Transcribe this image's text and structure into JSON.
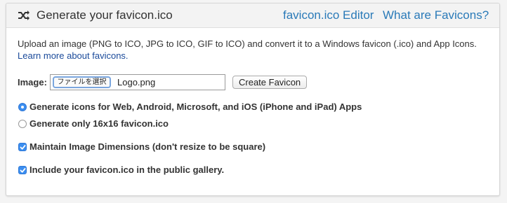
{
  "header": {
    "title": "Generate your favicon.ico",
    "icon": "shuffle-icon",
    "links": {
      "editor": "favicon.ico Editor",
      "what": "What are Favicons?"
    }
  },
  "intro": {
    "text": "Upload an image (PNG to ICO, JPG to ICO, GIF to ICO) and convert it to a Windows favicon (.ico) and App Icons.",
    "link": "Learn more about favicons."
  },
  "upload": {
    "label": "Image:",
    "choose_button": "ファイルを選択",
    "file_name": "Logo.png",
    "create_button": "Create Favicon"
  },
  "options": {
    "radio_all": {
      "label": "Generate icons for Web, Android, Microsoft, and iOS (iPhone and iPad) Apps",
      "selected": true
    },
    "radio_16": {
      "label": "Generate only 16x16 favicon.ico",
      "selected": false
    },
    "maintain_dimensions": {
      "label": "Maintain Image Dimensions (don't resize to be square)",
      "checked": true
    },
    "public_gallery": {
      "label": "Include your favicon.ico in the public gallery.",
      "checked": true
    }
  },
  "colors": {
    "link": "#2a7ab8",
    "accent": "#3b8ef0"
  }
}
